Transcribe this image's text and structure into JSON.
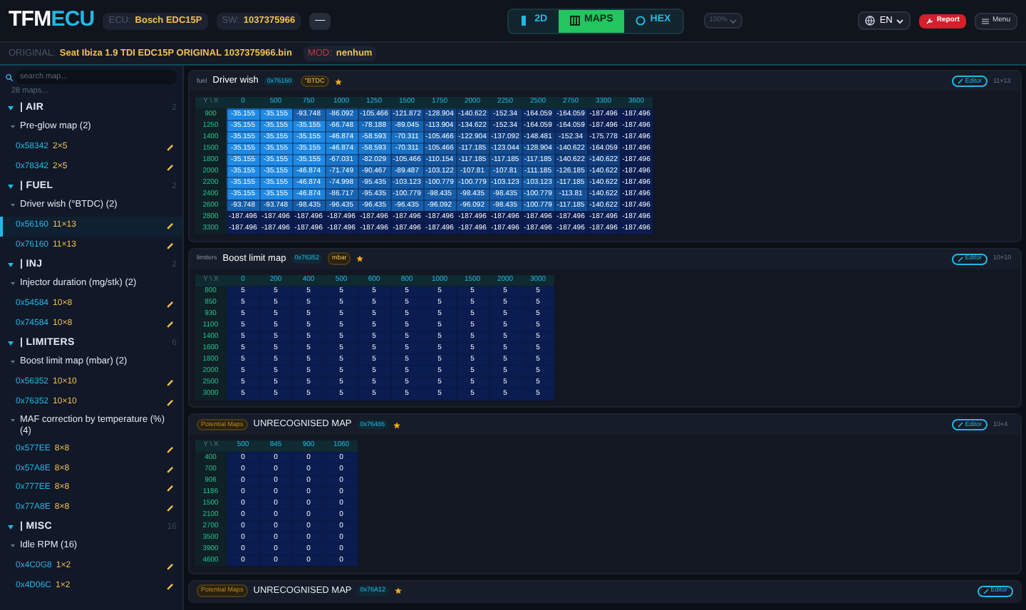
{
  "top_bar": {
    "logo_main": "TFM",
    "logo_accent": "ECU",
    "ecu_label": "ECU:",
    "ecu_value": "Bosch EDC15P",
    "sw_label": "SW:",
    "sw_value": "1037375966",
    "collapse": "—",
    "view_tabs": [
      {
        "label": "2D",
        "selected": false
      },
      {
        "label": "MAPS",
        "selected": true
      },
      {
        "label": "HEX",
        "selected": false
      }
    ],
    "zoom": "100%",
    "language": "EN",
    "report": "Report",
    "menu": "Menu"
  },
  "file_bar": {
    "original_label": "ORIGINAL:",
    "original_file": "Seat Ibiza 1.9 TDI EDC15P ORIGINAL 1037375966.bin",
    "mod_label": "MOD:",
    "mod_value": "nenhum"
  },
  "sidebar": {
    "search_placeholder": "search map...",
    "count": "28 maps...",
    "categories": [
      {
        "name": "| AIR",
        "count": "2",
        "expanded": true,
        "groups": [
          {
            "name": "Pre-glow map (2)",
            "expanded": true,
            "items": [
              {
                "address": "0x58342",
                "size": "2×5",
                "selected": false
              },
              {
                "address": "0x78342",
                "size": "2×5",
                "selected": false
              }
            ]
          }
        ]
      },
      {
        "name": "| FUEL",
        "count": "2",
        "expanded": true,
        "groups": [
          {
            "name": "Driver wish (°BTDC) (2)",
            "expanded": true,
            "items": [
              {
                "address": "0x56160",
                "size": "11×13",
                "selected": true
              },
              {
                "address": "0x76160",
                "size": "11×13",
                "selected": false
              }
            ]
          }
        ]
      },
      {
        "name": "| INJ",
        "count": "2",
        "expanded": true,
        "groups": [
          {
            "name": "Injector duration (mg/stk) (2)",
            "expanded": true,
            "items": [
              {
                "address": "0x54584",
                "size": "10×8",
                "selected": false
              },
              {
                "address": "0x74584",
                "size": "10×8",
                "selected": false
              }
            ]
          }
        ]
      },
      {
        "name": "| LIMITERS",
        "count": "6",
        "expanded": true,
        "groups": [
          {
            "name": "Boost limit map (mbar) (2)",
            "expanded": true,
            "items": [
              {
                "address": "0x56352",
                "size": "10×10",
                "selected": false
              },
              {
                "address": "0x76352",
                "size": "10×10",
                "selected": false
              }
            ]
          },
          {
            "name": "MAF correction by temperature (%) (4)",
            "expanded": true,
            "items": [
              {
                "address": "0x577EE",
                "size": "8×8",
                "selected": false
              },
              {
                "address": "0x57A8E",
                "size": "8×8",
                "selected": false
              },
              {
                "address": "0x777EE",
                "size": "8×8",
                "selected": false
              },
              {
                "address": "0x77A8E",
                "size": "8×8",
                "selected": false
              }
            ]
          }
        ]
      },
      {
        "name": "| MISC",
        "count": "16",
        "expanded": true,
        "groups": [
          {
            "name": "Idle RPM (16)",
            "expanded": true,
            "items": [
              {
                "address": "0x4C0G8",
                "size": "1×2",
                "selected": false
              },
              {
                "address": "0x4D06C",
                "size": "1×2",
                "selected": false
              }
            ]
          }
        ]
      }
    ]
  },
  "panels": [
    {
      "tag": "fuel",
      "kind": "plain",
      "title": "Driver wish",
      "address": "0x76160",
      "unit": "°BTDC",
      "editor": "Editor",
      "size": "11×13",
      "table": {
        "corner": "Y \\ X",
        "columns": [
          "0",
          "500",
          "750",
          "1000",
          "1250",
          "1500",
          "1750",
          "2000",
          "2250",
          "2500",
          "2750",
          "3300",
          "3600"
        ],
        "rows": [
          {
            "label": "900",
            "cells": [
              "-35.155",
              "-35.155",
              "-93.748",
              "-86.092",
              "-105.466",
              "-121.872",
              "-128.904",
              "-140.622",
              "-152.34",
              "-164.059",
              "-164.059",
              "-187.496",
              "-187.496"
            ]
          },
          {
            "label": "1250",
            "cells": [
              "-35.155",
              "-35.155",
              "-35.155",
              "-66.748",
              "-78.188",
              "-89.045",
              "-113.904",
              "-134.622",
              "-152.34",
              "-164.059",
              "-164.059",
              "-187.496",
              "-187.496"
            ]
          },
          {
            "label": "1400",
            "cells": [
              "-35.155",
              "-35.155",
              "-35.155",
              "-46.874",
              "-58.593",
              "-70.311",
              "-105.466",
              "-122.904",
              "-137.092",
              "-148.481",
              "-152.34",
              "-175.778",
              "-187.496"
            ]
          },
          {
            "label": "1500",
            "cells": [
              "-35.155",
              "-35.155",
              "-35.155",
              "-46.874",
              "-58.593",
              "-70.311",
              "-105.466",
              "-117.185",
              "-123.044",
              "-128.904",
              "-140.622",
              "-164.059",
              "-187.496"
            ]
          },
          {
            "label": "1800",
            "cells": [
              "-35.155",
              "-35.155",
              "-35.155",
              "-67.031",
              "-82.029",
              "-105.466",
              "-110.154",
              "-117.185",
              "-117.185",
              "-117.185",
              "-140.622",
              "-140.622",
              "-187.496"
            ]
          },
          {
            "label": "2000",
            "cells": [
              "-35.155",
              "-35.155",
              "-46.874",
              "-71.749",
              "-90.467",
              "-89.487",
              "-103.122",
              "-107.81",
              "-107.81",
              "-111.185",
              "-126.185",
              "-140.622",
              "-187.496"
            ]
          },
          {
            "label": "2200",
            "cells": [
              "-35.155",
              "-35.155",
              "-46.874",
              "-74.998",
              "-95.435",
              "-103.123",
              "-100.779",
              "-100.779",
              "-103.123",
              "-103.123",
              "-117.185",
              "-140.622",
              "-187.496"
            ]
          },
          {
            "label": "2400",
            "cells": [
              "-35.155",
              "-35.155",
              "-46.874",
              "-86.717",
              "-95.435",
              "-100.779",
              "-98.435",
              "-98.435",
              "-98.435",
              "-100.779",
              "-113.81",
              "-140.622",
              "-187.496"
            ]
          },
          {
            "label": "2600",
            "cells": [
              "-93.748",
              "-93.748",
              "-98.435",
              "-96.435",
              "-96.435",
              "-96.435",
              "-96.092",
              "-96.092",
              "-98.435",
              "-100.779",
              "-117.185",
              "-140.622",
              "-187.496"
            ]
          },
          {
            "label": "2800",
            "cells": [
              "-187.496",
              "-187.496",
              "-187.496",
              "-187.496",
              "-187.496",
              "-187.496",
              "-187.496",
              "-187.496",
              "-187.496",
              "-187.496",
              "-187.496",
              "-187.496",
              "-187.496"
            ]
          },
          {
            "label": "3300",
            "cells": [
              "-187.496",
              "-187.496",
              "-187.496",
              "-187.496",
              "-187.496",
              "-187.496",
              "-187.496",
              "-187.496",
              "-187.496",
              "-187.496",
              "-187.496",
              "-187.496",
              "-187.496"
            ]
          }
        ]
      }
    },
    {
      "tag": "limiters",
      "kind": "plain",
      "title": "Boost limit map",
      "address": "0x76352",
      "unit": "mbar",
      "editor": "Editor",
      "size": "10×10",
      "table": {
        "corner": "Y \\ X",
        "columns": [
          "0",
          "200",
          "400",
          "500",
          "600",
          "800",
          "1000",
          "1500",
          "2000",
          "3000"
        ],
        "rows": [
          {
            "label": "800",
            "cells": [
              "5",
              "5",
              "5",
              "5",
              "5",
              "5",
              "5",
              "5",
              "5",
              "5"
            ]
          },
          {
            "label": "850",
            "cells": [
              "5",
              "5",
              "5",
              "5",
              "5",
              "5",
              "5",
              "5",
              "5",
              "5"
            ]
          },
          {
            "label": "930",
            "cells": [
              "5",
              "5",
              "5",
              "5",
              "5",
              "5",
              "5",
              "5",
              "5",
              "5"
            ]
          },
          {
            "label": "1100",
            "cells": [
              "5",
              "5",
              "5",
              "5",
              "5",
              "5",
              "5",
              "5",
              "5",
              "5"
            ]
          },
          {
            "label": "1400",
            "cells": [
              "5",
              "5",
              "5",
              "5",
              "5",
              "5",
              "5",
              "5",
              "5",
              "5"
            ]
          },
          {
            "label": "1600",
            "cells": [
              "5",
              "5",
              "5",
              "5",
              "5",
              "5",
              "5",
              "5",
              "5",
              "5"
            ]
          },
          {
            "label": "1800",
            "cells": [
              "5",
              "5",
              "5",
              "5",
              "5",
              "5",
              "5",
              "5",
              "5",
              "5"
            ]
          },
          {
            "label": "2000",
            "cells": [
              "5",
              "5",
              "5",
              "5",
              "5",
              "5",
              "5",
              "5",
              "5",
              "5"
            ]
          },
          {
            "label": "2500",
            "cells": [
              "5",
              "5",
              "5",
              "5",
              "5",
              "5",
              "5",
              "5",
              "5",
              "5"
            ]
          },
          {
            "label": "3000",
            "cells": [
              "5",
              "5",
              "5",
              "5",
              "5",
              "5",
              "5",
              "5",
              "5",
              "5"
            ]
          }
        ]
      }
    },
    {
      "tag": "Potential Maps",
      "kind": "badge",
      "title": "UNRECOGNISED MAP",
      "address": "0x76486",
      "editor": "Editor",
      "size": "10×4",
      "table": {
        "corner": "Y \\ X",
        "columns": [
          "500",
          "845",
          "900",
          "1060"
        ],
        "rows": [
          {
            "label": "400",
            "cells": [
              "0",
              "0",
              "0",
              "0"
            ]
          },
          {
            "label": "700",
            "cells": [
              "0",
              "0",
              "0",
              "0"
            ]
          },
          {
            "label": "906",
            "cells": [
              "0",
              "0",
              "0",
              "0"
            ]
          },
          {
            "label": "1186",
            "cells": [
              "0",
              "0",
              "0",
              "0"
            ]
          },
          {
            "label": "1500",
            "cells": [
              "0",
              "0",
              "0",
              "0"
            ]
          },
          {
            "label": "2100",
            "cells": [
              "0",
              "0",
              "0",
              "0"
            ]
          },
          {
            "label": "2700",
            "cells": [
              "0",
              "0",
              "0",
              "0"
            ]
          },
          {
            "label": "3500",
            "cells": [
              "0",
              "0",
              "0",
              "0"
            ]
          },
          {
            "label": "3900",
            "cells": [
              "0",
              "0",
              "0",
              "0"
            ]
          },
          {
            "label": "4600",
            "cells": [
              "0",
              "0",
              "0",
              "0"
            ]
          }
        ]
      }
    },
    {
      "tag": "Potential Maps",
      "kind": "badge",
      "title": "UNRECOGNISED MAP",
      "address": "0x76A12",
      "editor": "Editor"
    }
  ]
}
